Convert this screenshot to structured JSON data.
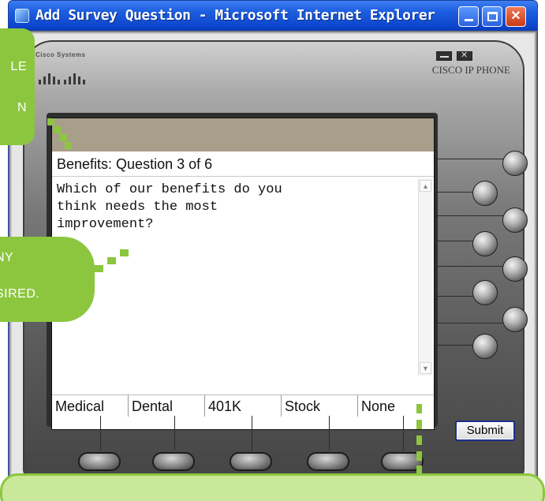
{
  "window": {
    "title": "Add Survey Question - Microsoft Internet Explorer",
    "controls": {
      "minimize": "minimize-icon",
      "maximize": "maximize-icon",
      "close": "close-icon"
    }
  },
  "phone": {
    "brand": "Cisco Systems",
    "model": "CISCO IP PHONE",
    "screen": {
      "title": "Benefits: Question 3 of 6",
      "question": "Which of our benefits do you\nthink needs the most\nimprovement?",
      "softkeys": [
        "Medical",
        "Dental",
        "401K",
        "Stock",
        "None"
      ]
    },
    "submit_label": "Submit"
  },
  "callouts": {
    "top_left_lines": [
      "LE",
      "N"
    ],
    "middle_left_lines": [
      "NY",
      "SIRED."
    ]
  },
  "colors": {
    "callout_green": "#8cc63f",
    "titlebar_blue": "#0d45cc",
    "screen_header": "#a89f8a"
  }
}
